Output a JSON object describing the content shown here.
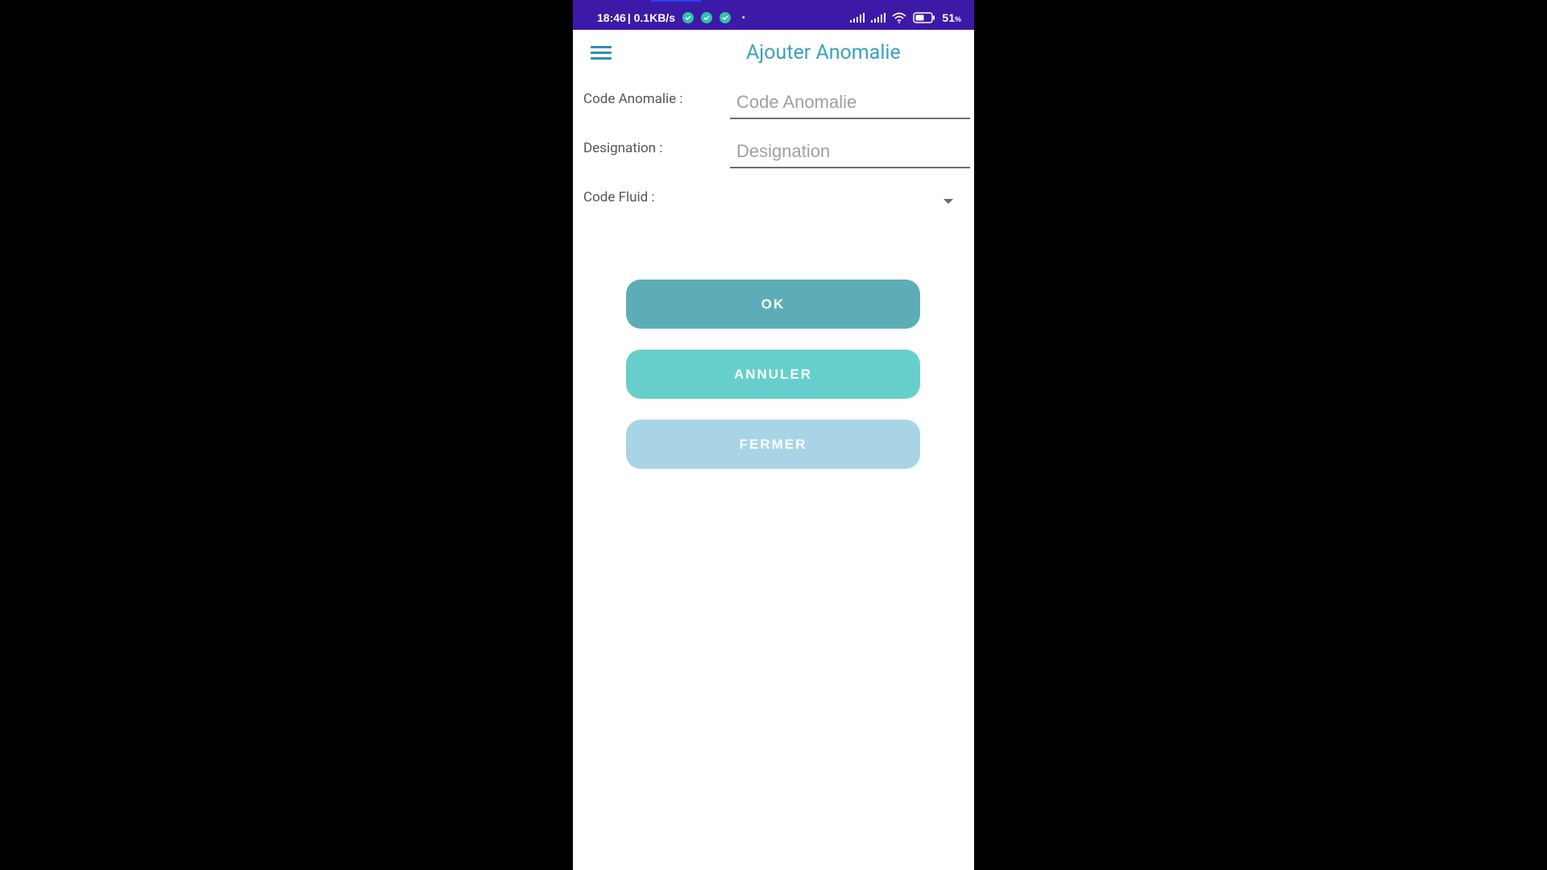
{
  "status_bar": {
    "time": "18:46",
    "network_speed": "| 0.1KB/s",
    "dot": "•",
    "battery_percent": "51",
    "battery_unit": "%",
    "icons": [
      "check-circle-icon",
      "check-circle-icon",
      "check-circle-icon",
      "signal-icon",
      "signal-icon",
      "wifi-icon",
      "battery-icon"
    ]
  },
  "app_bar": {
    "title": "Ajouter Anomalie",
    "menu_icon": "hamburger-menu-icon"
  },
  "form": {
    "code_anomalie": {
      "label": "Code Anomalie :",
      "placeholder": "Code Anomalie",
      "value": ""
    },
    "designation": {
      "label": "Designation :",
      "placeholder": "Designation",
      "value": ""
    },
    "code_fluid": {
      "label": "Code Fluid :",
      "selected": ""
    }
  },
  "buttons": {
    "ok": "OK",
    "annuler": "ANNULER",
    "fermer": "FERMER"
  },
  "colors": {
    "status_bar": "#3d19a8",
    "title": "#3aa2bb",
    "ok_button": "#5dadb9",
    "annuler_button": "#66cfcc",
    "fermer_button": "#a8d4e6"
  }
}
